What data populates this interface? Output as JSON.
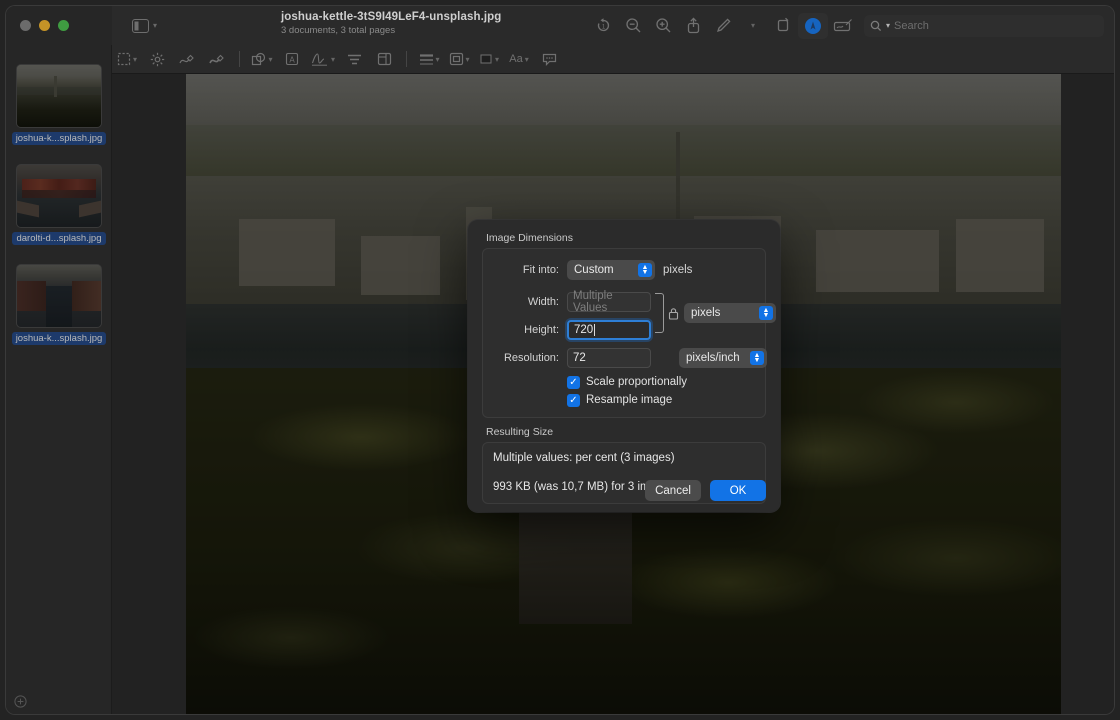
{
  "window": {
    "traffic_lights": [
      "close",
      "minimize",
      "maximize"
    ],
    "title": "joshua-kettle-3tS9I49LeF4-unsplash.jpg",
    "subtitle": "3 documents, 3 total pages"
  },
  "toolbar": {
    "sidebar_toggle_icon": "sidebar-icon",
    "items": [
      {
        "name": "rotate-left-icon",
        "label": "Rotate"
      },
      {
        "name": "zoom-out-icon",
        "label": "Zoom Out"
      },
      {
        "name": "zoom-in-icon",
        "label": "Zoom In"
      },
      {
        "name": "share-icon",
        "label": "Share"
      },
      {
        "name": "markup-pen-icon",
        "label": "Markup"
      },
      {
        "name": "chevron-down-icon",
        "label": ""
      },
      {
        "name": "crop-icon",
        "label": "Crop"
      },
      {
        "name": "annotate-icon",
        "label": "Annotate"
      },
      {
        "name": "sign-icon",
        "label": "Sign"
      }
    ],
    "search": {
      "icon": "search-icon",
      "placeholder": "Search",
      "value": ""
    }
  },
  "markupbar": {
    "items": [
      {
        "name": "selection-tool-icon",
        "chevron": true
      },
      {
        "name": "instant-alpha-icon",
        "chevron": false
      },
      {
        "name": "sketch-icon",
        "chevron": false
      },
      {
        "name": "draw-icon",
        "chevron": false
      },
      {
        "name": "shapes-icon",
        "chevron": true
      },
      {
        "name": "text-icon",
        "chevron": false
      },
      {
        "name": "sign-icon",
        "chevron": true
      },
      {
        "name": "adjust-color-icon",
        "chevron": false
      },
      {
        "name": "adjust-size-icon",
        "chevron": false
      },
      {
        "name": "shape-style-icon",
        "chevron": true
      },
      {
        "name": "border-color-icon",
        "chevron": true
      },
      {
        "name": "fill-color-icon",
        "chevron": true
      },
      {
        "name": "text-style-icon",
        "chevron": true,
        "text": "Aa"
      },
      {
        "name": "comment-icon",
        "chevron": false
      }
    ]
  },
  "sidebar": {
    "thumbnails": [
      {
        "label": "joshua-k...splash.jpg",
        "selected": true,
        "scene": "aerial-city"
      },
      {
        "label": "darolti-d...splash.jpg",
        "selected": true,
        "scene": "red-warehouses"
      },
      {
        "label": "joshua-k...splash.jpg",
        "selected": true,
        "scene": "canal"
      }
    ],
    "add_button_icon": "plus-circle-icon"
  },
  "dialog": {
    "sections": {
      "image_dimensions": {
        "title": "Image Dimensions",
        "fit_into": {
          "label": "Fit into:",
          "value": "Custom",
          "unit_suffix": "pixels"
        },
        "width": {
          "label": "Width:",
          "value": "",
          "placeholder": "Multiple Values"
        },
        "height": {
          "label": "Height:",
          "value": "720",
          "focused": true
        },
        "resolution": {
          "label": "Resolution:",
          "value": "72"
        },
        "size_unit": {
          "value": "pixels"
        },
        "resolution_unit": {
          "value": "pixels/inch"
        },
        "lock_icon": "lock-closed-icon",
        "checkboxes": [
          {
            "label": "Scale proportionally",
            "checked": true
          },
          {
            "label": "Resample image",
            "checked": true
          }
        ]
      },
      "resulting_size": {
        "title": "Resulting Size",
        "line1": "Multiple values: per cent (3 images)",
        "line2": "993 KB (was 10,7 MB) for 3 images"
      }
    },
    "buttons": {
      "cancel": "Cancel",
      "ok": "OK"
    }
  },
  "colors": {
    "accent_blue": "#1273e6",
    "window_bg": "#2a2a2a",
    "dialog_bg": "#2b2b2b",
    "selection_blue": "#1d3a6b"
  }
}
